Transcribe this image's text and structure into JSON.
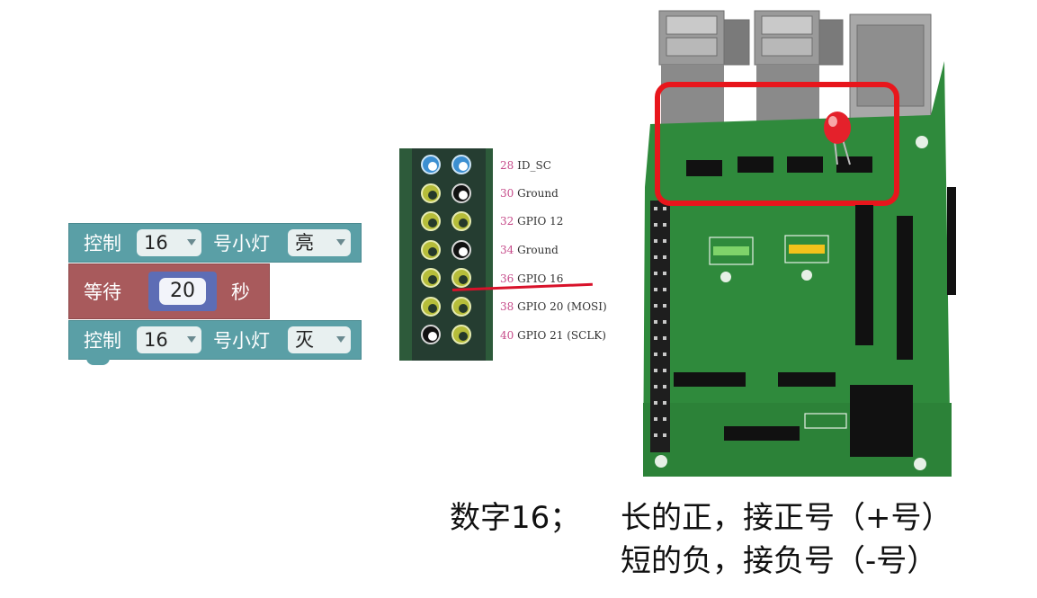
{
  "blocks": [
    {
      "prefix": "控制",
      "pin": "16",
      "mid": "号小灯",
      "state": "亮"
    },
    {
      "prefix": "等待",
      "value": "20",
      "suffix": "秒"
    },
    {
      "prefix": "控制",
      "pin": "16",
      "mid": "号小灯",
      "state": "灭"
    }
  ],
  "header": {
    "pins": [
      {
        "num": "28",
        "name": "ID_SC"
      },
      {
        "num": "30",
        "name": "Ground"
      },
      {
        "num": "32",
        "name": "GPIO 12"
      },
      {
        "num": "34",
        "name": "Ground"
      },
      {
        "num": "36",
        "name": "GPIO 16"
      },
      {
        "num": "38",
        "name": "GPIO 20 (MOSI)"
      },
      {
        "num": "40",
        "name": "GPIO 21 (SCLK)"
      }
    ]
  },
  "caption": {
    "line1_left": "数字16；",
    "line1_right": "长的正，接正号（+号）",
    "line2": "短的负，接负号（-号）"
  },
  "colors": {
    "block_teal": "#5a9fa6",
    "block_red": "#a85a5c",
    "board_green": "#2f8a3c",
    "highlight_red": "#e8161c",
    "marker_red": "#d8122a"
  }
}
